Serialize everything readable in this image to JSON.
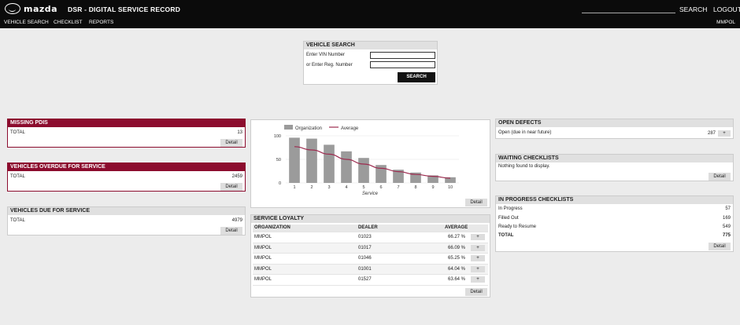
{
  "header": {
    "logo_text": "mazda",
    "app_title": "DSR - DIGITAL SERVICE RECORD",
    "search_label": "SEARCH",
    "logout_label": "LOGOUT",
    "nav": [
      "VEHICLE SEARCH",
      "CHECKLIST",
      "REPORTS"
    ],
    "user": "MMPOL"
  },
  "vehicle_search": {
    "title": "VEHICLE SEARCH",
    "vin_label": "Enter VIN Number",
    "reg_label": "or Enter Reg. Number",
    "vin_value": "",
    "reg_value": "",
    "button": "SEARCH"
  },
  "missing_pdis": {
    "title": "MISSING PDIS",
    "label": "TOTAL",
    "value": "13",
    "detail": "Detail"
  },
  "overdue": {
    "title": "VEHICLES OVERDUE FOR SERVICE",
    "label": "TOTAL",
    "value": "2459",
    "detail": "Detail"
  },
  "due": {
    "title": "VEHICLES DUE FOR SERVICE",
    "label": "TOTAL",
    "value": "4979",
    "detail": "Detail"
  },
  "chart_data": {
    "type": "bar",
    "categories": [
      "1",
      "2",
      "3",
      "4",
      "5",
      "6",
      "7",
      "8",
      "9",
      "10"
    ],
    "series": [
      {
        "name": "Organization",
        "type": "bar",
        "values": [
          96,
          94,
          81,
          67,
          53,
          38,
          28,
          22,
          16,
          12
        ],
        "color": "#9b9b9b"
      },
      {
        "name": "Average",
        "type": "line",
        "values": [
          77,
          70,
          61,
          50,
          40,
          31,
          24,
          18,
          14,
          10
        ],
        "color": "#9c2a4e"
      }
    ],
    "xlabel": "Service",
    "ylabel": "",
    "ylim": [
      0,
      100
    ],
    "yticks": [
      0,
      50,
      100
    ],
    "legend": "top",
    "detail": "Detail"
  },
  "loyalty": {
    "title": "SERVICE LOYALTY",
    "columns": [
      "ORGANIZATION",
      "DEALER",
      "AVERAGE"
    ],
    "rows": [
      {
        "org": "MMPOL",
        "dealer": "01023",
        "avg": "66.27 %"
      },
      {
        "org": "MMPOL",
        "dealer": "01017",
        "avg": "66.09 %"
      },
      {
        "org": "MMPOL",
        "dealer": "01046",
        "avg": "65.25 %"
      },
      {
        "org": "MMPOL",
        "dealer": "01001",
        "avg": "64.04 %"
      },
      {
        "org": "MMPOL",
        "dealer": "01527",
        "avg": "63.64 %"
      }
    ],
    "plus": "+",
    "detail": "Detail"
  },
  "open_defects": {
    "title": "OPEN DEFECTS",
    "label": "Open (due in near future)",
    "value": "287",
    "plus": "+"
  },
  "waiting": {
    "title": "WAITING CHECKLISTS",
    "message": "Nothing found to display.",
    "detail": "Detail"
  },
  "in_progress": {
    "title": "IN PROGRESS CHECKLISTS",
    "rows": [
      {
        "label": "In Progress",
        "value": "57"
      },
      {
        "label": "Filled Out",
        "value": "169"
      },
      {
        "label": "Ready to Resume",
        "value": "549"
      },
      {
        "label": "TOTAL",
        "value": "775"
      }
    ],
    "detail": "Detail"
  }
}
